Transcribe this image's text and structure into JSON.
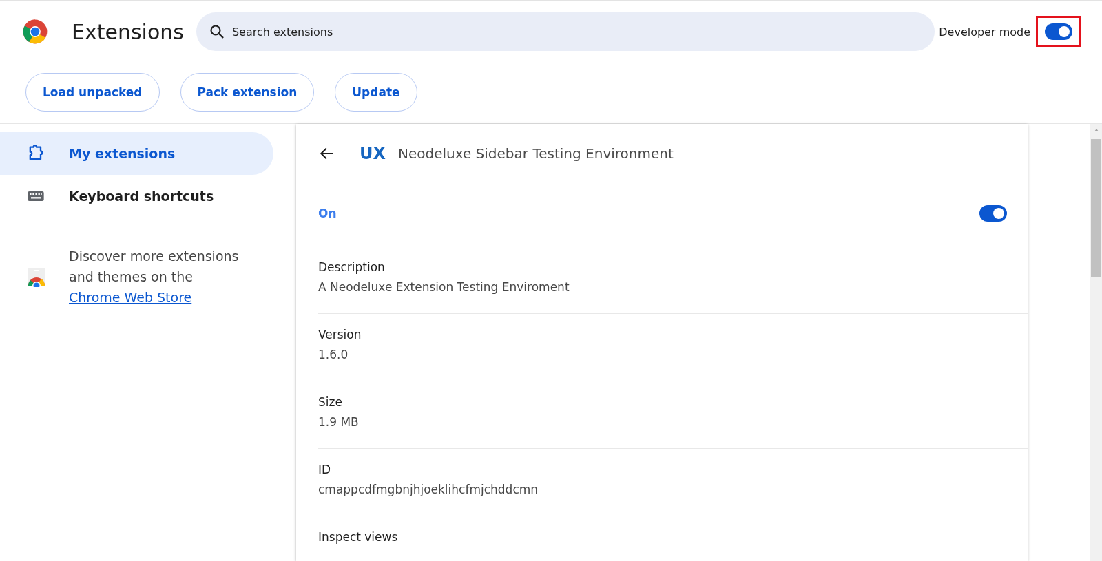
{
  "header": {
    "title": "Extensions",
    "search": {
      "placeholder": "Search extensions"
    },
    "developer_mode": {
      "label": "Developer mode",
      "on": true,
      "highlighted": true
    }
  },
  "toolbar": {
    "buttons": [
      "Load unpacked",
      "Pack extension",
      "Update"
    ]
  },
  "sidebar": {
    "items": [
      {
        "label": "My extensions",
        "kind": "puzzle",
        "selected": true
      },
      {
        "label": "Keyboard shortcuts",
        "kind": "keyboard",
        "selected": false
      }
    ],
    "store_promo": {
      "text": "Discover more extensions and themes on the ",
      "link": "Chrome Web Store"
    }
  },
  "details": {
    "logo": "UX",
    "name": "Neodeluxe Sidebar Testing Environment",
    "enabled_label": "On",
    "enabled": true,
    "fields": [
      {
        "label": "Description",
        "value": "A Neodeluxe Extension Testing Enviroment"
      },
      {
        "label": "Version",
        "value": "1.6.0"
      },
      {
        "label": "Size",
        "value": "1.9 MB"
      },
      {
        "label": "ID",
        "value": "cmappcdfmgbnjhjoeklihcfmjchddcmn"
      },
      {
        "label": "Inspect views"
      }
    ]
  }
}
